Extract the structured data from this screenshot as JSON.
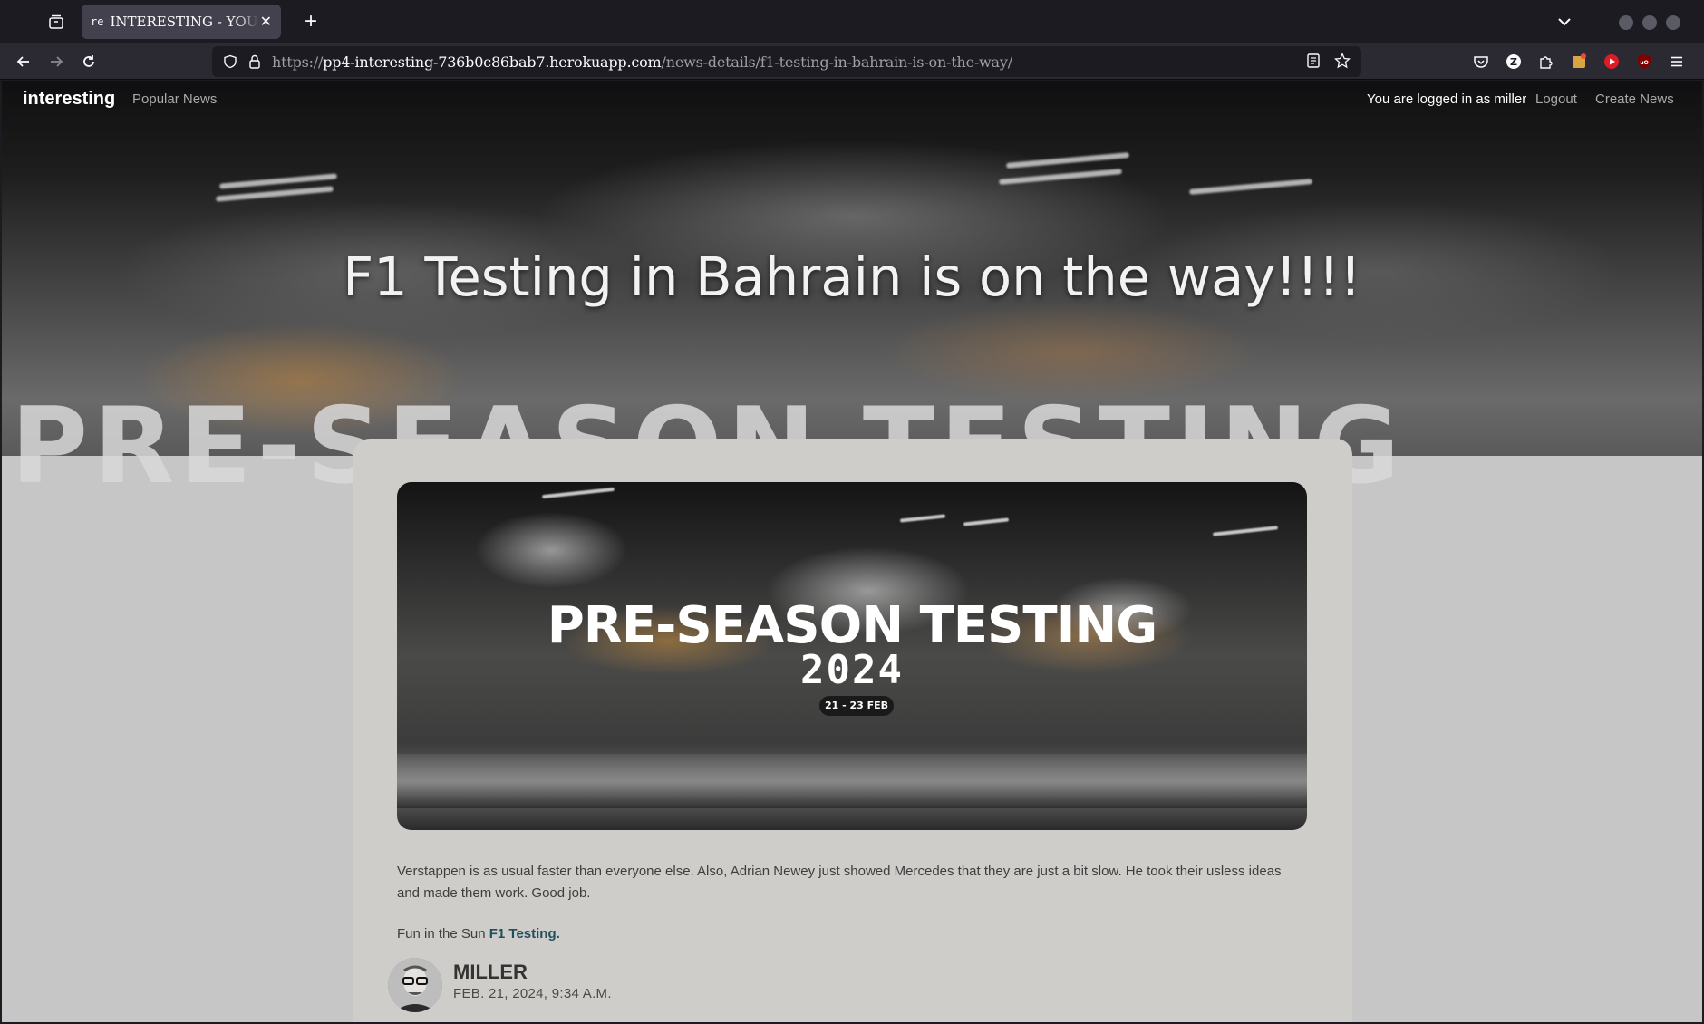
{
  "browser": {
    "tab_favicon": "re",
    "tab_title": "INTERESTING - YOUR NEWS",
    "url_scheme": "https://",
    "url_host": "pp4-interesting-736b0c86bab7.herokuapp.com",
    "url_path": "/news-details/f1-testing-in-bahrain-is-on-the-way/"
  },
  "site_nav": {
    "brand": "interesting",
    "popular": "Popular News",
    "login_status": "You are logged in as miller",
    "logout": "Logout",
    "create": "Create News"
  },
  "hero": {
    "title": "F1 Testing in Bahrain is on the way!!!!",
    "background_text": "PRE-SEASON TESTING"
  },
  "image": {
    "headline": "PRE-SEASON TESTING",
    "year": "2024",
    "dates": "21 - 23 FEB"
  },
  "article": {
    "paragraph1": "Verstappen is as usual faster than everyone else. Also, Adrian Newey just showed Mercedes that they are just a bit slow. He took their usless ideas and made them work. Good job.",
    "paragraph2_prefix": "Fun in the Sun ",
    "paragraph2_link": "F1 Testing."
  },
  "author": {
    "name": "MILLER",
    "date": "FEB. 21, 2024, 9:34 A.M."
  },
  "colors": {
    "chrome_bg": "#1c1b22",
    "page_bg": "#c6c6c6",
    "card_bg": "#cfcdca",
    "link": "#1f4e5f"
  }
}
